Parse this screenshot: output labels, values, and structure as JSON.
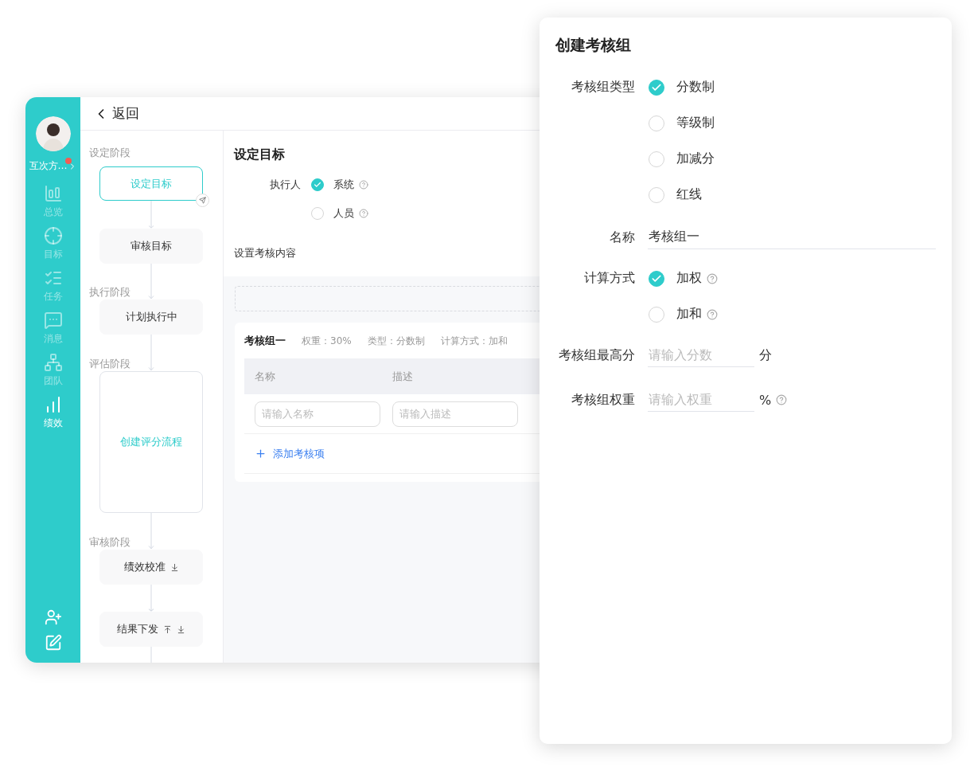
{
  "sidebar": {
    "user": {
      "name": "互次方…",
      "notification": true
    },
    "items": [
      {
        "label": "总览",
        "selected": false
      },
      {
        "label": "目标",
        "selected": false
      },
      {
        "label": "任务",
        "selected": false
      },
      {
        "label": "消息",
        "selected": false
      },
      {
        "label": "团队",
        "selected": false
      },
      {
        "label": "绩效",
        "selected": true
      }
    ]
  },
  "header": {
    "back": "返回"
  },
  "flow": {
    "steps": [
      {
        "stage": "设定阶段",
        "label": "设定目标",
        "kind": "current"
      },
      {
        "label": "审核目标",
        "kind": "normal"
      },
      {
        "stage": "执行阶段",
        "label": "计划执行中",
        "kind": "normal"
      },
      {
        "stage": "评估阶段",
        "label": "创建评分流程",
        "kind": "draft"
      },
      {
        "stage": "审核阶段",
        "label": "绩效校准",
        "kind": "normal",
        "move_up": false,
        "move_down": true
      },
      {
        "label": "结果下发",
        "kind": "normal",
        "move_up": true,
        "move_down": true
      }
    ]
  },
  "main": {
    "title": "设定目标",
    "executor": {
      "label": "执行人",
      "options": [
        {
          "label": "系统",
          "selected": true
        },
        {
          "label": "人员",
          "selected": false
        }
      ]
    },
    "content_title": "设置考核内容",
    "group": {
      "name": "考核组一",
      "meta": [
        "权重：30%",
        "类型：分数制",
        "计算方式：加和"
      ],
      "columns": [
        "名称",
        "描述"
      ],
      "inputs": [
        {
          "placeholder": "请输入名称"
        },
        {
          "placeholder": "请输入描述"
        }
      ],
      "add": "添加考核项"
    }
  },
  "dialog": {
    "title": "创建考核组",
    "type": {
      "label": "考核组类型",
      "options": [
        {
          "label": "分数制",
          "selected": true
        },
        {
          "label": "等级制",
          "selected": false
        },
        {
          "label": "加减分",
          "selected": false
        },
        {
          "label": "红线",
          "selected": false
        }
      ]
    },
    "name": {
      "label": "名称",
      "value": "考核组一"
    },
    "method": {
      "label": "计算方式",
      "options": [
        {
          "label": "加权",
          "selected": true
        },
        {
          "label": "加和",
          "selected": false
        }
      ]
    },
    "max_score": {
      "label": "考核组最高分",
      "placeholder": "请输入分数",
      "unit": "分"
    },
    "weight": {
      "label": "考核组权重",
      "placeholder": "请输入权重",
      "unit": "%"
    }
  }
}
